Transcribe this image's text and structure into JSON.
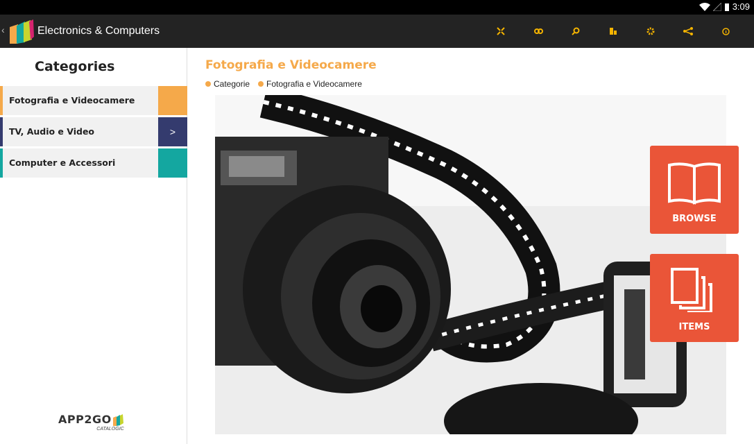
{
  "status_bar": {
    "time": "3:09"
  },
  "app_bar": {
    "title": "Electronics & Computers",
    "actions": [
      {
        "icon": "expand-icon"
      },
      {
        "icon": "link-icon"
      },
      {
        "icon": "search-icon"
      },
      {
        "icon": "building-icon"
      },
      {
        "icon": "settings-icon"
      },
      {
        "icon": "share-icon"
      },
      {
        "icon": "info-icon"
      }
    ]
  },
  "sidebar": {
    "heading": "Categories",
    "items": [
      {
        "label": "Fotografia e Videocamere",
        "color": "#f5a94a",
        "arrow": ""
      },
      {
        "label": "TV, Audio e Video",
        "color": "#343b6e",
        "arrow": ">"
      },
      {
        "label": "Computer e Accessori",
        "color": "#14a7a0",
        "arrow": ""
      }
    ],
    "brand_name": "APP2GO",
    "brand_sub": "CATALOGIC"
  },
  "main": {
    "title": "Fotografia e Videocamere",
    "breadcrumbs": [
      "Categorie",
      "Fotografia e Videocamere"
    ],
    "accent": "#f5a94a"
  },
  "actions": {
    "browse_label": "BROWSE",
    "items_label": "ITEMS",
    "color": "#ea5538"
  }
}
